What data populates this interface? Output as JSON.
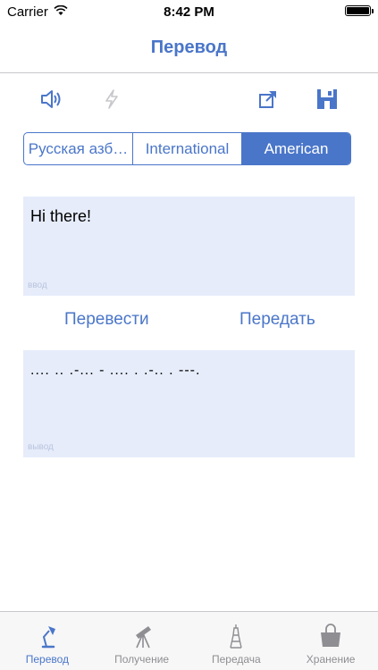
{
  "status_bar": {
    "carrier": "Carrier",
    "time": "8:42 PM"
  },
  "nav": {
    "title": "Перевод"
  },
  "toolbar": {
    "icons": [
      "speaker-icon",
      "flash-icon",
      "share-icon",
      "save-icon"
    ]
  },
  "segmented": {
    "options": [
      "Русская азб…",
      "International",
      "American"
    ],
    "selected": "American"
  },
  "input": {
    "text": "Hi there!",
    "hint": "ввод"
  },
  "actions": {
    "translate_label": "Перевести",
    "transmit_label": "Передать"
  },
  "output": {
    "text": ".... .. .-... - .... . .-.. . ---.",
    "hint": "вывод"
  },
  "tabs": [
    {
      "label": "Перевод",
      "icon": "lamp-icon",
      "active": true
    },
    {
      "label": "Получение",
      "icon": "telescope-icon",
      "active": false
    },
    {
      "label": "Передача",
      "icon": "tower-icon",
      "active": false
    },
    {
      "label": "Хранение",
      "icon": "bag-icon",
      "active": false
    }
  ],
  "colors": {
    "accent": "#4a76c9",
    "text_box_bg": "#e6ecfa",
    "inactive": "#8e8e93"
  }
}
